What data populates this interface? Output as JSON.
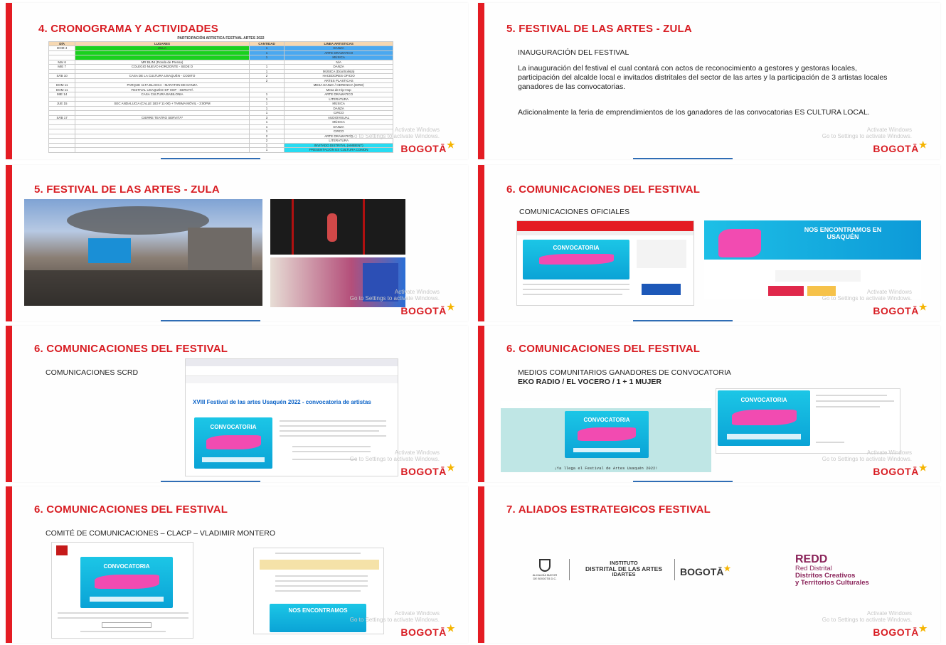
{
  "common": {
    "logo_text": "BOGOTĀ",
    "watermark_line1": "Activate Windows",
    "watermark_line2": "Go to Settings to activate Windows."
  },
  "slide1": {
    "title": "4. CRONOGRAMA Y ACTIVIDADES",
    "table_caption": "PARTICIPACIÓN ARTISTICA FESTIVAL ARTES 2022",
    "headers": [
      "DÍA",
      "LUGARES",
      "CANTIDAD",
      "LINEA ARTISTICAS"
    ],
    "rows": [
      [
        "DOM 4",
        "ZULA",
        "1",
        "DANZA"
      ],
      [
        "",
        "",
        "1",
        "ARTE DRAMATICO"
      ],
      [
        "",
        "",
        "1",
        "MÚSICA"
      ],
      [
        "Mar 6",
        "MR BLINI (Ronda de Prensa)",
        "",
        "N/A"
      ],
      [
        "MIE 7",
        "COLEGIO NUEVO HORIZONTE - SEDE D",
        "1",
        "DANZA"
      ],
      [
        "",
        "",
        "1",
        "MÚSICA (Dúo/Solista)"
      ],
      [
        "SÁB 10",
        "CASA DE LA CULTURA USAQUÉN - CODITO",
        "2",
        "HACEDORES OFICIO"
      ],
      [
        "",
        "",
        "2",
        "ARTES PLASTICAS"
      ],
      [
        "DOM 11",
        "PARQUE ALTA BLANCA - MARATON DE DANZA",
        "",
        "MESA DANZA / GERENCIA (IDRD)"
      ],
      [
        "DOM 11",
        "FESTIVAL USAQUÉN HIP HOP - SERVITÁ",
        "",
        "Mesa de Hip-Hop"
      ],
      [
        "MIE 14",
        "CASA CULTURA BABILONIA",
        "1",
        "ARTE DRAMATICO"
      ],
      [
        "",
        "",
        "1",
        "LITERATURA"
      ],
      [
        "JUE 15",
        "SEC ANDALUCIA (CALLE 183 # 11-00) + TARIMA MÓVIL - 3:00PM",
        "1",
        "MÚSICA"
      ],
      [
        "",
        "",
        "1",
        "DANZA"
      ],
      [
        "",
        "",
        "1",
        "CIRCO"
      ],
      [
        "SÁB 17",
        "CIERRE TEATRO SERVITÁ*",
        "3",
        "AUDIOVISUAL"
      ],
      [
        "",
        "",
        "1",
        "MÚSICA"
      ],
      [
        "",
        "",
        "1",
        "DANZA"
      ],
      [
        "",
        "",
        "1",
        "CIRCO"
      ],
      [
        "",
        "",
        "2",
        "ARTE DRAMATICO"
      ],
      [
        "",
        "",
        "2",
        "LITERATURA"
      ],
      [
        "",
        "",
        "1",
        "INVITADO DISTRITAL (AMBIENT)"
      ],
      [
        "",
        "",
        "1",
        "PRESENTACIÓN ES CULTURA COMÚN"
      ]
    ]
  },
  "slide2": {
    "title": "5. FESTIVAL DE LAS ARTES - ZULA",
    "subtitle": "INAUGURACIÓN DEL FESTIVAL",
    "paragraph1": "La inauguración del festival el cual contará con actos de reconocimiento a gestores y gestoras locales, participación del alcalde local e invitados distritales del sector de las artes y la participación de 3 artistas locales ganadores de las convocatorias.",
    "paragraph2": "Adicionalmente la feria de emprendimientos de los ganadores de las convocatorias ES CULTURA LOCAL."
  },
  "slide3": {
    "title": "5. FESTIVAL DE LAS ARTES - ZULA"
  },
  "slide4": {
    "title": "6. COMUNICACIONES DEL FESTIVAL",
    "subtitle": "COMUNICACIONES OFICIALES"
  },
  "slide5": {
    "title": "6. COMUNICACIONES DEL FESTIVAL",
    "subtitle": "COMUNICACIONES  SCRD",
    "page_heading": "XVIII Festival de las artes Usaquén 2022 - convocatoria de artistas"
  },
  "slide6": {
    "title": "6. COMUNICACIONES DEL FESTIVAL",
    "subtitle": "MEDIOS COMUNITARIOS GANADORES DE CONVOCATORIA",
    "subtitle_bold": "EKO RADIO / EL VOCERO / 1 + 1 MUJER",
    "caption": "¡Ya llega el Festival de Artes Usaquén 2022!"
  },
  "slide7": {
    "title": "6. COMUNICACIONES DEL FESTIVAL",
    "subtitle": "COMITÉ DE COMUNICACIONES – CLACP – VLADIMIR MONTERO"
  },
  "slide8": {
    "title": "7. ALIADOS ESTRATEGICOS FESTIVAL",
    "alcaldia": "ALCALDÍA MAYOR DE BOGOTÁ D.C.",
    "idartes_line1": "INSTITUTO",
    "idartes_line2": "DISTRITAL DE LAS ARTES",
    "idartes_line3": "IDARTES",
    "bogota": "BOGOTĀ",
    "redd_title": "REDD",
    "redd_line1": "Red Distrital",
    "redd_line2": "Distritos Creativos",
    "redd_line3": "y Territorios Culturales"
  }
}
